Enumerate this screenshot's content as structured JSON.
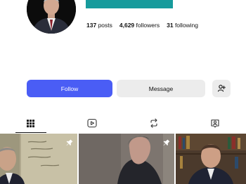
{
  "profile": {
    "stats": {
      "posts_count": "137",
      "posts_label": "posts",
      "followers_count": "4,629",
      "followers_label": "followers",
      "following_count": "31",
      "following_label": "following"
    }
  },
  "actions": {
    "follow_label": "Follow",
    "message_label": "Message",
    "add_user_icon": "person-add-icon"
  },
  "tabs": [
    {
      "icon": "grid-icon",
      "active": true
    },
    {
      "icon": "reels-icon",
      "active": false
    },
    {
      "icon": "repost-icon",
      "active": false
    },
    {
      "icon": "tagged-icon",
      "active": false
    }
  ],
  "posts": [
    {
      "thumbnail": "man-at-chalkboard",
      "pinned": true
    },
    {
      "thumbnail": "man-in-profile",
      "pinned": true
    },
    {
      "thumbnail": "man-in-library",
      "pinned": false
    }
  ],
  "colors": {
    "accent": "#4a5df5",
    "teal": "#179b9c",
    "secondary_button": "#ececec"
  }
}
